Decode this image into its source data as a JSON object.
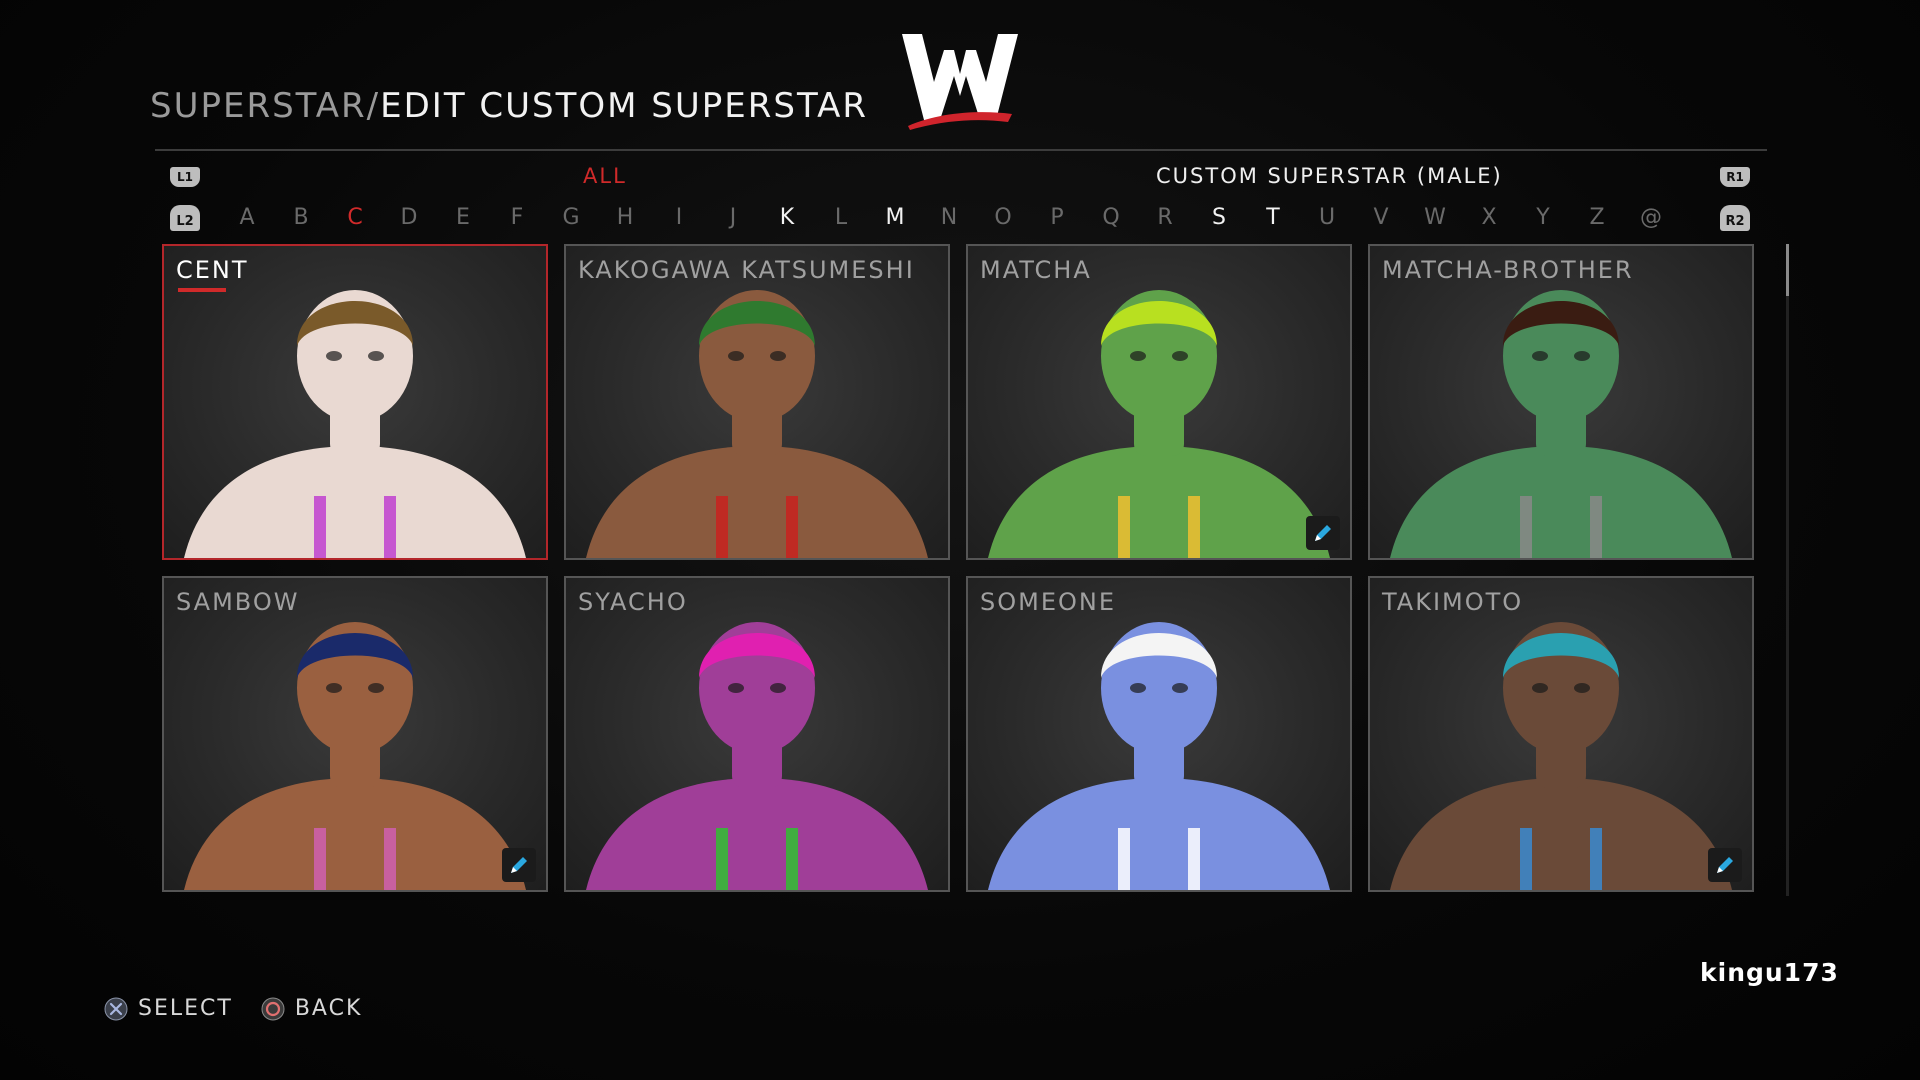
{
  "header": {
    "breadcrumb": "SUPERSTAR/",
    "title": "EDIT CUSTOM SUPERSTAR",
    "logo_icon": "wwe-logo"
  },
  "filters": {
    "l1_label": "L1",
    "r1_label": "R1",
    "l2_label": "L2",
    "r2_label": "R2",
    "all_label": "ALL",
    "category_label": "CUSTOM SUPERSTAR (MALE)"
  },
  "alphabet": [
    {
      "char": "A",
      "state": "empty"
    },
    {
      "char": "B",
      "state": "empty"
    },
    {
      "char": "C",
      "state": "active"
    },
    {
      "char": "D",
      "state": "empty"
    },
    {
      "char": "E",
      "state": "empty"
    },
    {
      "char": "F",
      "state": "empty"
    },
    {
      "char": "G",
      "state": "empty"
    },
    {
      "char": "H",
      "state": "empty"
    },
    {
      "char": "I",
      "state": "empty"
    },
    {
      "char": "J",
      "state": "empty"
    },
    {
      "char": "K",
      "state": "has"
    },
    {
      "char": "L",
      "state": "empty"
    },
    {
      "char": "M",
      "state": "has"
    },
    {
      "char": "N",
      "state": "empty"
    },
    {
      "char": "O",
      "state": "empty"
    },
    {
      "char": "P",
      "state": "empty"
    },
    {
      "char": "Q",
      "state": "empty"
    },
    {
      "char": "R",
      "state": "empty"
    },
    {
      "char": "S",
      "state": "has"
    },
    {
      "char": "T",
      "state": "has"
    },
    {
      "char": "U",
      "state": "empty"
    },
    {
      "char": "V",
      "state": "empty"
    },
    {
      "char": "W",
      "state": "empty"
    },
    {
      "char": "X",
      "state": "empty"
    },
    {
      "char": "Y",
      "state": "empty"
    },
    {
      "char": "Z",
      "state": "empty"
    },
    {
      "char": "@",
      "state": "empty"
    }
  ],
  "superstars": [
    {
      "name": "CENT",
      "selected": true,
      "edited": false,
      "skin": "#e9d9d2",
      "accent": "#c040d0",
      "hair": "#7a5a2a"
    },
    {
      "name": "KAKOGAWA KATSUMESHI",
      "selected": false,
      "edited": false,
      "skin": "#8a5a3e",
      "accent": "#c8221e",
      "hair": "#2f7a2f"
    },
    {
      "name": "MATCHA",
      "selected": false,
      "edited": true,
      "skin": "#5fa24a",
      "accent": "#f0c030",
      "hair": "#b8e020"
    },
    {
      "name": "MATCHA-BROTHER",
      "selected": false,
      "edited": false,
      "skin": "#4a8a5a",
      "accent": "#888888",
      "hair": "#3a1c12"
    },
    {
      "name": "SAMBOW",
      "selected": false,
      "edited": true,
      "skin": "#9a6040",
      "accent": "#d060b0",
      "hair": "#1a2a6a"
    },
    {
      "name": "SYACHO",
      "selected": false,
      "edited": false,
      "skin": "#a03e98",
      "accent": "#30c030",
      "hair": "#e020b0"
    },
    {
      "name": "SOMEONE",
      "selected": false,
      "edited": false,
      "skin": "#7a90e0",
      "accent": "#ffffff",
      "hair": "#f4f4f4"
    },
    {
      "name": "TAKIMOTO",
      "selected": false,
      "edited": true,
      "skin": "#6a4a38",
      "accent": "#3a8ad0",
      "hair": "#2aa0b0"
    }
  ],
  "watermark": "kingu173",
  "hints": {
    "select_icon": "cross-button-icon",
    "select_label": "SELECT",
    "back_icon": "circle-button-icon",
    "back_label": "BACK"
  }
}
